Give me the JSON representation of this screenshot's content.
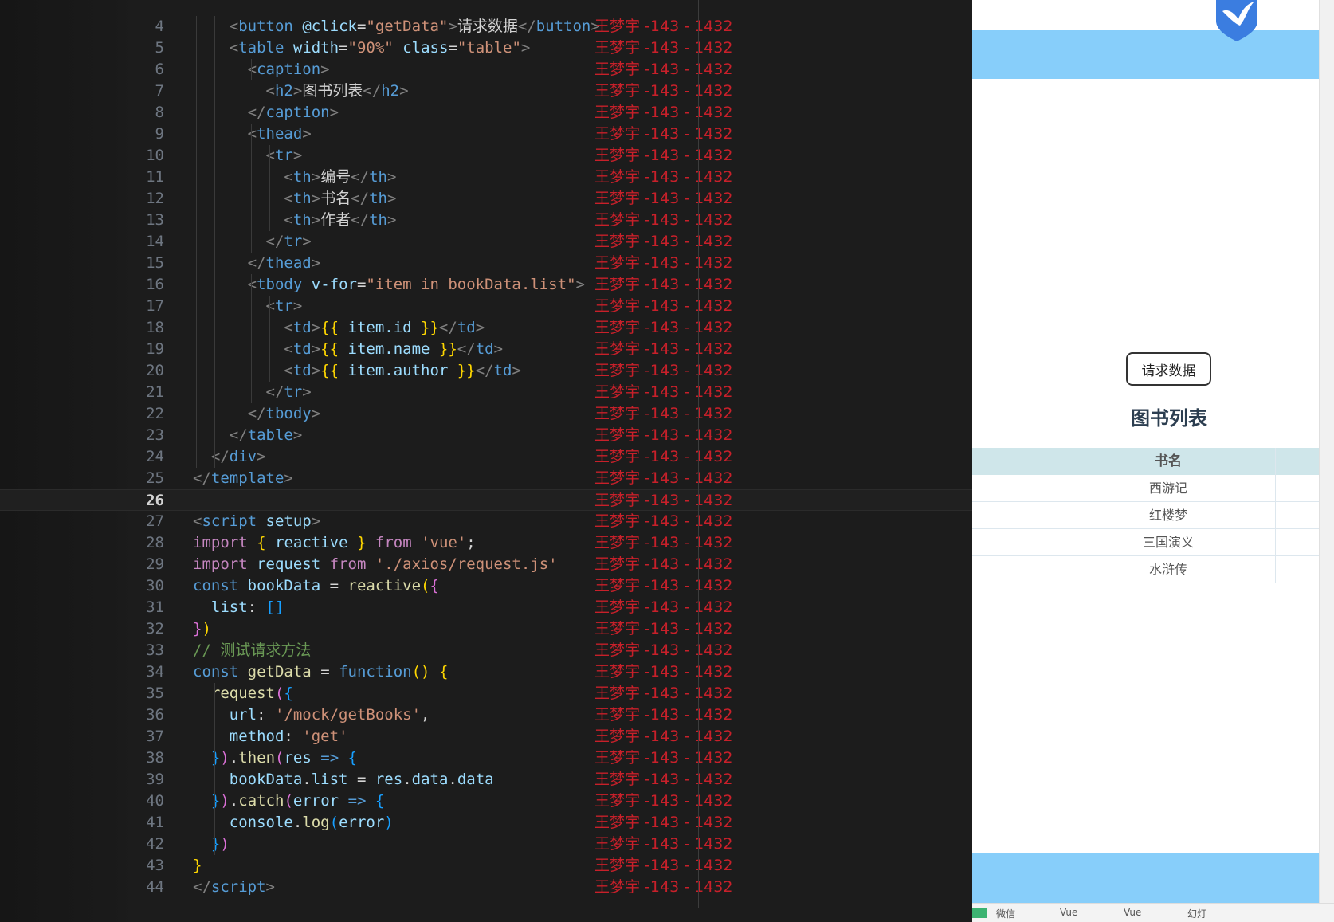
{
  "editor": {
    "active_line": "26",
    "watermark": "王梦宇 -143 - 1432",
    "lines": [
      {
        "n": "4"
      },
      {
        "n": "5"
      },
      {
        "n": "6"
      },
      {
        "n": "7"
      },
      {
        "n": "8"
      },
      {
        "n": "9"
      },
      {
        "n": "10"
      },
      {
        "n": "11"
      },
      {
        "n": "12"
      },
      {
        "n": "13"
      },
      {
        "n": "14"
      },
      {
        "n": "15"
      },
      {
        "n": "16"
      },
      {
        "n": "17"
      },
      {
        "n": "18"
      },
      {
        "n": "19"
      },
      {
        "n": "20"
      },
      {
        "n": "21"
      },
      {
        "n": "22"
      },
      {
        "n": "23"
      },
      {
        "n": "24"
      },
      {
        "n": "25"
      },
      {
        "n": "26"
      },
      {
        "n": "27"
      },
      {
        "n": "28"
      },
      {
        "n": "29"
      },
      {
        "n": "30"
      },
      {
        "n": "31"
      },
      {
        "n": "32"
      },
      {
        "n": "33"
      },
      {
        "n": "34"
      },
      {
        "n": "35"
      },
      {
        "n": "36"
      },
      {
        "n": "37"
      },
      {
        "n": "38"
      },
      {
        "n": "39"
      },
      {
        "n": "40"
      },
      {
        "n": "41"
      },
      {
        "n": "42"
      },
      {
        "n": "43"
      },
      {
        "n": "44"
      }
    ],
    "code": {
      "l4_text": "请求数据",
      "l4_attr_val": "\"getData\"",
      "l5_width": "\"90%\"",
      "l5_class": "\"table\"",
      "l7_text": "图书列表",
      "l11_text": "编号",
      "l12_text": "书名",
      "l13_text": "作者",
      "l16_vfor": "\"item in bookData.list\"",
      "l18_expr": "item.id",
      "l19_expr": "item.name",
      "l20_expr": "item.author",
      "l28_mod": "'vue'",
      "l29_mod": "'./axios/request.js'",
      "l33_comment": "// 测试请求方法",
      "l36_url": "'/mock/getBooks'",
      "l37_method": "'get'"
    }
  },
  "browser": {
    "button_label": "请求数据",
    "caption": "图书列表",
    "column_header": "书名",
    "rows": [
      "西游记",
      "红楼梦",
      "三国演义",
      "水浒传"
    ],
    "taskbar": [
      "微信",
      "Vue",
      "Vue",
      "幻灯"
    ]
  },
  "colors": {
    "editor_bg": "#1c1c1c",
    "accent_band": "#87cefa",
    "header_row": "#cfe6ea",
    "watermark": "#c8202a"
  }
}
